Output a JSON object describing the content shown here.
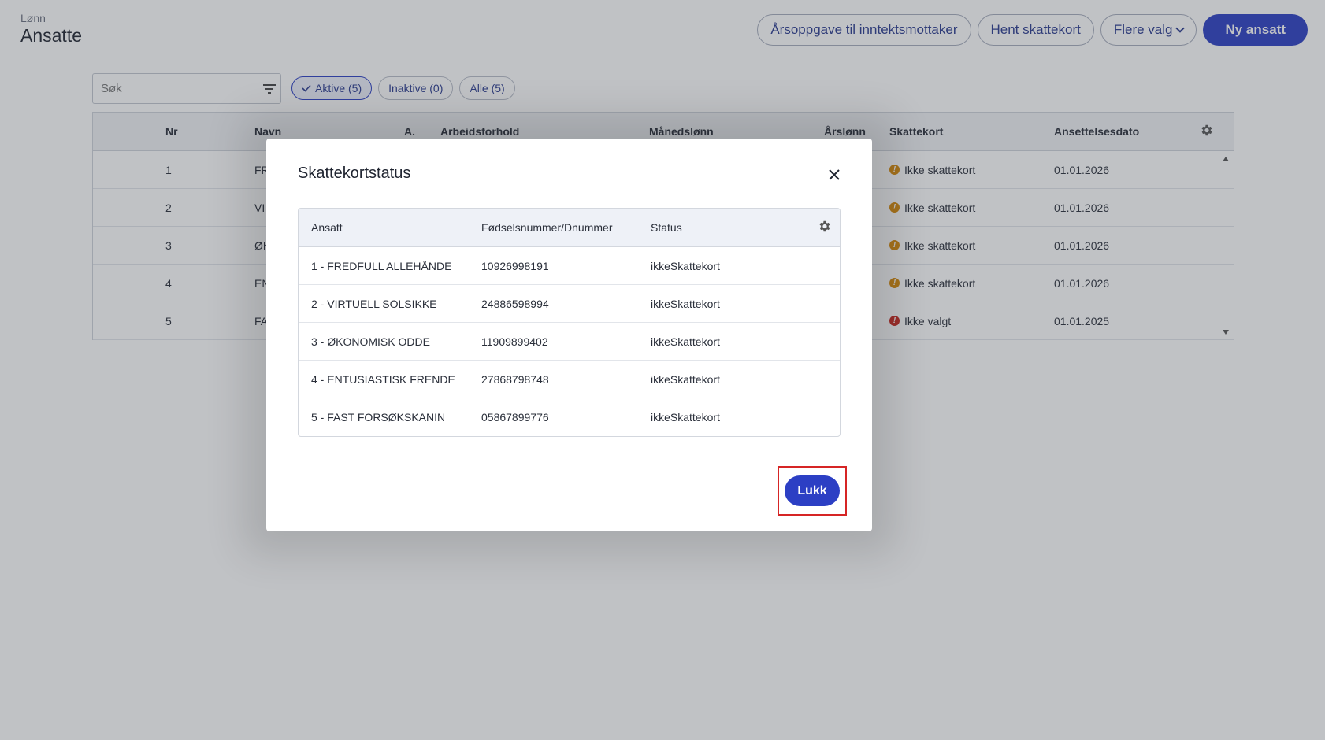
{
  "header": {
    "breadcrumb": "Lønn",
    "title": "Ansatte",
    "actions": {
      "arsoppgave": "Årsoppgave til inntektsmottaker",
      "hent_skattekort": "Hent skattekort",
      "flere_valg": "Flere valg",
      "ny_ansatt": "Ny ansatt"
    }
  },
  "filters": {
    "search_placeholder": "Søk",
    "chips": [
      "Aktive (5)",
      "Inaktive (0)",
      "Alle (5)"
    ]
  },
  "grid": {
    "columns": {
      "nr": "Nr",
      "navn": "Navn",
      "a": "A.",
      "arbeidsforhold": "Arbeidsforhold",
      "manedslonn": "Månedslønn",
      "arslonn": "Årslønn",
      "skattekort": "Skattekort",
      "ansettelsesdato": "Ansettelsesdato"
    },
    "rows": [
      {
        "nr": "1",
        "navn": "FR",
        "skattekort": "Ikke skattekort",
        "status": "warning",
        "dato": "01.01.2026"
      },
      {
        "nr": "2",
        "navn": "VI",
        "skattekort": "Ikke skattekort",
        "status": "warning",
        "dato": "01.01.2026"
      },
      {
        "nr": "3",
        "navn": "ØK",
        "skattekort": "Ikke skattekort",
        "status": "warning",
        "dato": "01.01.2026"
      },
      {
        "nr": "4",
        "navn": "EN",
        "skattekort": "Ikke skattekort",
        "status": "warning",
        "dato": "01.01.2026"
      },
      {
        "nr": "5",
        "navn": "FA",
        "skattekort": "Ikke valgt",
        "status": "error",
        "dato": "01.01.2025"
      }
    ]
  },
  "modal": {
    "title": "Skattekortstatus",
    "columns": {
      "ansatt": "Ansatt",
      "fodselsnummer": "Fødselsnummer/Dnummer",
      "status": "Status"
    },
    "rows": [
      {
        "ansatt": "1 - FREDFULL ALLEHÅNDE",
        "fnr": "10926998191",
        "status": "ikkeSkattekort"
      },
      {
        "ansatt": "2 - VIRTUELL SOLSIKKE",
        "fnr": "24886598994",
        "status": "ikkeSkattekort"
      },
      {
        "ansatt": "3 - ØKONOMISK ODDE",
        "fnr": "11909899402",
        "status": "ikkeSkattekort"
      },
      {
        "ansatt": "4 - ENTUSIASTISK FRENDE",
        "fnr": "27868798748",
        "status": "ikkeSkattekort"
      },
      {
        "ansatt": "5 - FAST FORSØKSKANIN",
        "fnr": "05867899776",
        "status": "ikkeSkattekort"
      }
    ],
    "close_label": "Lukk"
  },
  "colors": {
    "primary": "#2c3fc4",
    "warning": "#d88a06",
    "error": "#c8251d",
    "focus_outline": "#d62525"
  }
}
